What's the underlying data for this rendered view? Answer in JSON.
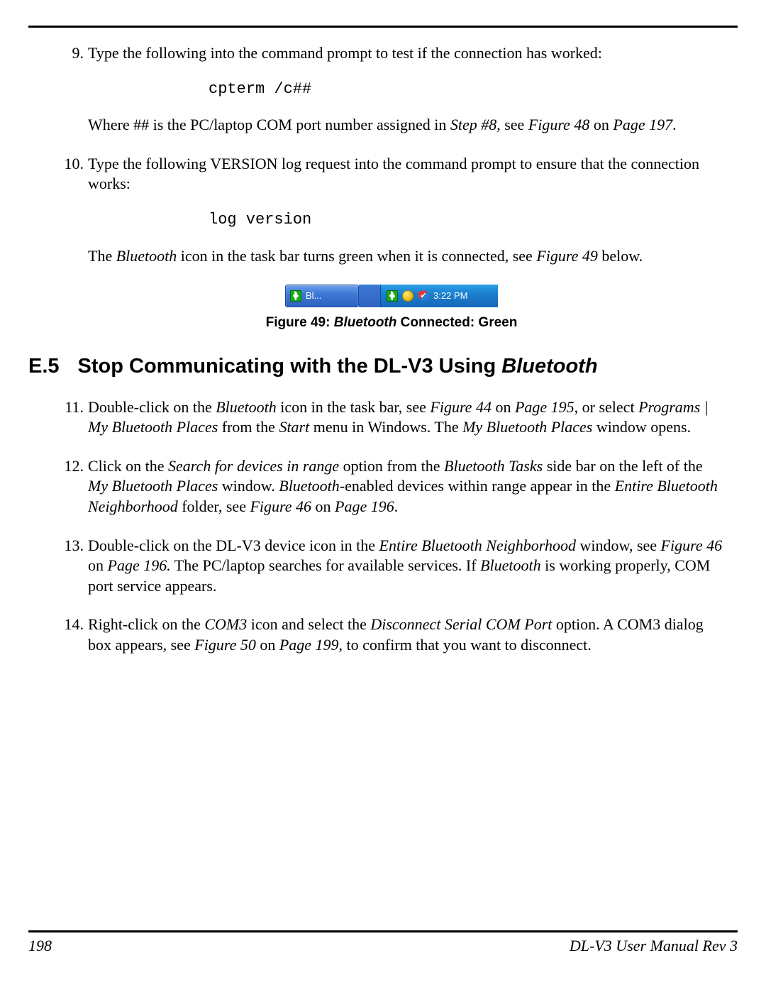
{
  "steps_a": [
    {
      "num": "9.",
      "intro": "Type the following into the command prompt to test if the connection has worked:",
      "code": "cpterm /c##",
      "after_html": "Where ## is the PC/laptop COM port number assigned in <span class=\"italic\">Step #8</span>, see <span class=\"italic\">Figure 48</span> on <span class=\"italic\">Page 197</span>."
    },
    {
      "num": "10.",
      "intro": "Type the following VERSION log request into the command prompt to ensure that the connection works:",
      "code": "log version",
      "after_html": "The <span class=\"italic\">Bluetooth</span> icon in the task bar turns green when it is connected, see <span class=\"italic\">Figure 49</span> below."
    }
  ],
  "taskbar": {
    "button_label": "Bl...",
    "time": "3:22 PM"
  },
  "caption": {
    "lead": "Figure 49: ",
    "subject": "Bluetooth",
    "tail": " Connected: Green"
  },
  "section": {
    "number": "E.5",
    "title_lead": "Stop Communicating with the DL-V3 Using ",
    "title_italic": "Bluetooth"
  },
  "steps_b": [
    {
      "num": "11.",
      "html": "Double-click on the <span class=\"italic\">Bluetooth</span> icon in the task bar, see <span class=\"italic\">Figure 44</span> on <span class=\"italic\">Page 195</span>, or select <span class=\"italic\">Programs | My Bluetooth Places</span> from the <span class=\"italic\">Start</span> menu in Windows. The <span class=\"italic\">My Bluetooth Places</span> window opens."
    },
    {
      "num": "12.",
      "html": "Click on the <span class=\"italic\">Search for devices in range</span> option from the <span class=\"italic\">Bluetooth Tasks</span> side bar on the left of the <span class=\"italic\">My Bluetooth Places</span> window. <span class=\"italic\">Bluetooth</span>-enabled devices within range appear in the <span class=\"italic\">Entire Bluetooth Neighborhood</span> folder, see <span class=\"italic\">Figure 46</span> on <span class=\"italic\">Page 196</span>."
    },
    {
      "num": "13.",
      "html": "Double-click on the DL-V3 device icon in the <span class=\"italic\">Entire Bluetooth Neighborhood</span> window, see <span class=\"italic\">Figure 46</span> on <span class=\"italic\">Page 196.</span> The PC/laptop searches for available services. If <span class=\"italic\">Bluetooth</span> is working properly, COM port service appears."
    },
    {
      "num": "14.",
      "html": "Right-click on the <span class=\"italic\">COM3</span> icon and select the <span class=\"italic\">Disconnect Serial COM Port</span> option. A COM3 dialog box appears, see <span class=\"italic\">Figure 50</span> on <span class=\"italic\">Page 199</span>, to confirm that you want to disconnect."
    }
  ],
  "footer": {
    "page": "198",
    "doc": "DL-V3 User Manual Rev 3"
  }
}
